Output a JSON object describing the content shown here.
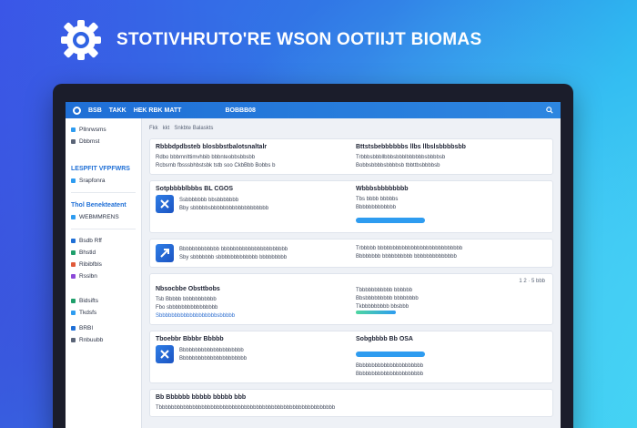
{
  "hero": {
    "title": "STOTIVHRUTO'RE WSON OOTIIJT BIOMAS",
    "logo_icon": "gear-icon"
  },
  "topbar": {
    "items": [
      "BSB",
      "TAKK",
      "HEK RBK MATT",
      "BOBBB08"
    ],
    "search_icon": "search-icon"
  },
  "sidebar": {
    "items": [
      {
        "label": "Pllnrwsms",
        "color": "#2e9cf0"
      },
      {
        "label": "Dbbmst",
        "color": "#5a6477"
      }
    ],
    "section1": "LESPFIT VFPFWRS",
    "section1_items": [
      {
        "label": "Srapfonra",
        "color": "#2e9cf0"
      }
    ],
    "section2": "Thol Benekteatent",
    "section2_items": [
      {
        "label": "WEBMMRENS",
        "color": "#2e9cf0"
      }
    ],
    "section3_items": [
      {
        "label": "Bsdb Rff",
        "color": "#1f6fd6"
      },
      {
        "label": "Bhstld",
        "color": "#1f9f6b"
      },
      {
        "label": "Ribibfbls",
        "color": "#e05a3a"
      },
      {
        "label": "Rsslbn",
        "color": "#8c4ad8"
      },
      {
        "label": "Bidsifts",
        "color": "#1f9f6b"
      },
      {
        "label": "Tkdsfs",
        "color": "#2e9cf0"
      },
      {
        "label": "BRBI",
        "color": "#1f6fd6"
      },
      {
        "label": "Rnbuubb",
        "color": "#5a6477"
      }
    ]
  },
  "breadcrumb": [
    "Fkk",
    "kkt",
    "Snkbte Balaskts"
  ],
  "cards": [
    {
      "left": {
        "title": "Rbbbdpdbsteb blosbbstbalotsnaltalr",
        "lines": [
          "Rdbo bbbmnlttimvhbib bbbnteobbsbbsbb",
          "Rcbsrnb fbsssbhbstsbk tstb soo CkbBbb Bobbs b"
        ]
      },
      "right": {
        "title": "Bttstsbebbbbbbs llbs llbslsbbbbsbb",
        "lines": [
          "Trbbbsbbbllbbbsbbblbbbbbbsbbbbsb",
          "Bobbsbbbbsbbbbsb tbbttbsbbbbsb"
        ]
      }
    },
    {
      "left": {
        "title": "Sotpbbbblbbbs BL CGOS",
        "lines": [
          "Ssbbbbbbb bbsbbbbbbb",
          "Bby sbbbbbsbbbbbbbbbbbbbbbbbbb"
        ],
        "icon": "close-icon"
      },
      "right": {
        "title": "Wbbbsbbbbbbbb",
        "lines": [
          "Tbs bbbb bbbbbs",
          "Bbbbbbbbbbbbb"
        ],
        "button_label": ""
      }
    },
    {
      "left": {
        "title": "",
        "lines": [
          "Bbbbbbbbbbbbb bbbbbbbbbbbbbbbbbbbbbb",
          "Sby sbbbbbbb sbbbbbbbbbbbbb bbbbbbbbb"
        ],
        "icon": "arrow-icon"
      },
      "right": {
        "title": "",
        "lines": [
          "Trbbbbb bbbbbbbbbbbbbbbbbbbbbbbbbbbb",
          "Bbbbbbbb bbbbbbbbbb bbbbbbbbbbbbbb"
        ]
      }
    },
    {
      "pager": "1 2 · 5 bbb",
      "left": {
        "title": "Nbsocbbe Obsttbobs",
        "lines": [
          "Tsb Bbbbb bbbbbbbbbbb",
          "Fbo sbbbbbbbbbbbbbbbb",
          "Sbbbbbbbbbbbbbbbbbbbsbbbbb"
        ]
      },
      "right": {
        "title": "",
        "lines": [
          "Tbbbbbbbbbbb bbbbbb",
          "Bbsbbbbbbbbb bbbbbbbb",
          "Tkbbbbbbbbb bbsbbb"
        ]
      }
    },
    {
      "left": {
        "title": "Tboebbr Bbbbr Bbbbb",
        "lines": [
          "Bbbbbbbbbbbbbbbbbbbbb",
          "Bbbbbbbbbbbbbbbbbbbbbb"
        ],
        "icon": "close-icon"
      },
      "right": {
        "title": "Sobgbbbb Bb OSA",
        "lines": [
          "Bbbbbbbbbbbbbbbbbbbbbb",
          "Bbbbbbbbbbbbbbbbbbbbbb"
        ]
      }
    },
    {
      "left": {
        "title": "Bb Bbbbbb bbbbb bbbbb bbb",
        "lines": [
          "Tbbbbbbbbbbbbbbbbbbbbbbbbbbbbbbbbbbbbbbbbbbbbbbbbbbbbbbbbbb"
        ]
      }
    }
  ]
}
